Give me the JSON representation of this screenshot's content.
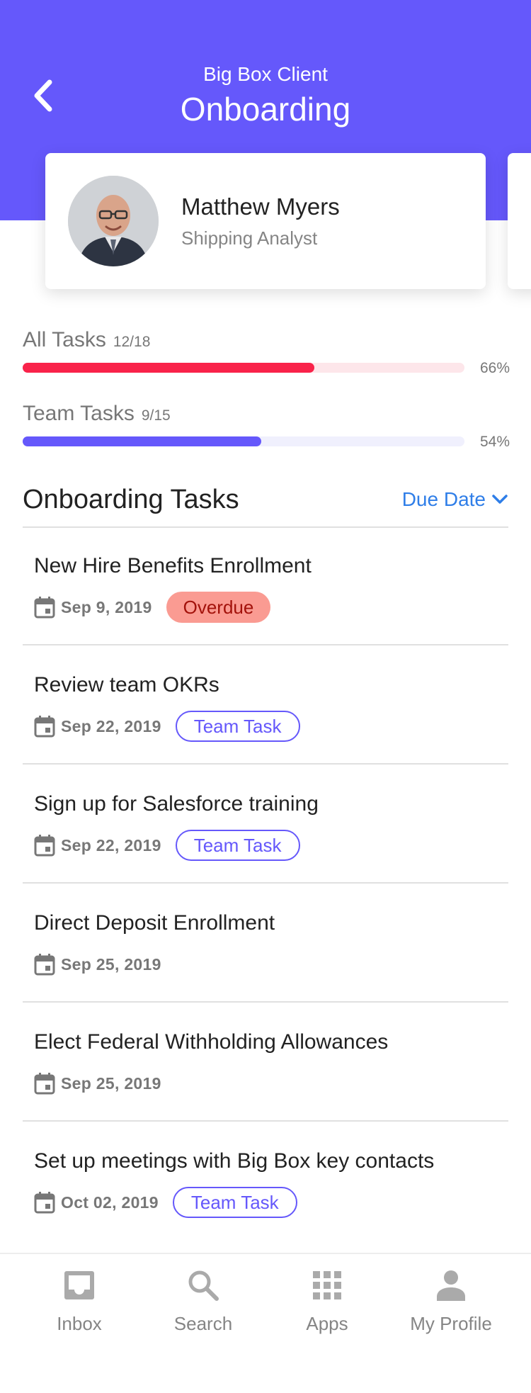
{
  "header": {
    "subtitle": "Big Box Client",
    "title": "Onboarding"
  },
  "profile": {
    "name": "Matthew Myers",
    "role": "Shipping Analyst"
  },
  "progress": [
    {
      "label": "All Tasks",
      "count": "12/18",
      "percent_text": "66%",
      "fraction": 0.66,
      "color": "#f9234a",
      "track_color": "#fde6ea"
    },
    {
      "label": "Team Tasks",
      "count": "9/15",
      "percent_text": "54%",
      "fraction": 0.54,
      "color": "#6558fb",
      "track_color": "#f0f0fd"
    }
  ],
  "tasks_section": {
    "title": "Onboarding Tasks",
    "sort_label": "Due Date"
  },
  "tasks": [
    {
      "title": "New Hire Benefits Enrollment",
      "date": "Sep 9, 2019",
      "badge": "Overdue",
      "badge_type": "overdue"
    },
    {
      "title": "Review team OKRs",
      "date": "Sep 22, 2019",
      "badge": "Team Task",
      "badge_type": "team"
    },
    {
      "title": "Sign up for Salesforce training",
      "date": "Sep 22, 2019",
      "badge": "Team Task",
      "badge_type": "team"
    },
    {
      "title": "Direct Deposit Enrollment",
      "date": "Sep 25, 2019",
      "badge": "",
      "badge_type": "none"
    },
    {
      "title": "Elect Federal Withholding Allowances",
      "date": "Sep 25, 2019",
      "badge": "",
      "badge_type": "none"
    },
    {
      "title": "Set up meetings with Big Box key contacts",
      "date": "Oct 02, 2019",
      "badge": "Team Task",
      "badge_type": "team"
    }
  ],
  "tabbar": {
    "items": [
      {
        "label": "Inbox",
        "icon": "inbox-icon"
      },
      {
        "label": "Search",
        "icon": "search-icon"
      },
      {
        "label": "Apps",
        "icon": "apps-grid-icon"
      },
      {
        "label": "My Profile",
        "icon": "person-icon"
      }
    ]
  },
  "colors": {
    "brand": "#6558fb",
    "link": "#2f7ee8",
    "overdue_bg": "#fa9b92",
    "overdue_text": "#a3120b",
    "all_tasks_bar": "#f9234a"
  }
}
